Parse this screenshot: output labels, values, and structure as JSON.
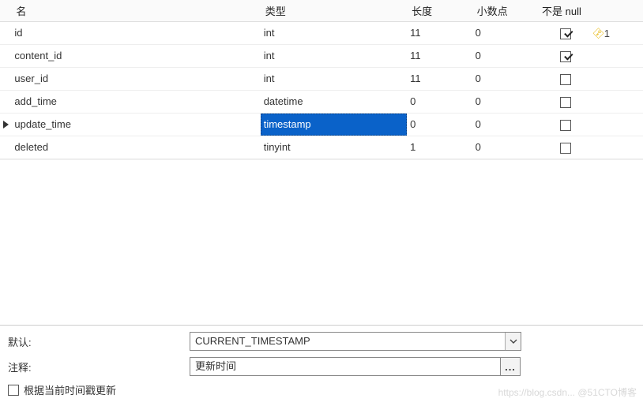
{
  "headers": {
    "name": "名",
    "type": "类型",
    "length": "长度",
    "decimals": "小数点",
    "not_null": "不是 null"
  },
  "rows": [
    {
      "name": "id",
      "type": "int",
      "length": "11",
      "decimals": "0",
      "not_null": true,
      "pk_index": "1",
      "current": false,
      "editing": false
    },
    {
      "name": "content_id",
      "type": "int",
      "length": "11",
      "decimals": "0",
      "not_null": true,
      "pk_index": "",
      "current": false,
      "editing": false
    },
    {
      "name": "user_id",
      "type": "int",
      "length": "11",
      "decimals": "0",
      "not_null": false,
      "pk_index": "",
      "current": false,
      "editing": false
    },
    {
      "name": "add_time",
      "type": "datetime",
      "length": "0",
      "decimals": "0",
      "not_null": false,
      "pk_index": "",
      "current": false,
      "editing": false
    },
    {
      "name": "update_time",
      "type": "timestamp",
      "length": "0",
      "decimals": "0",
      "not_null": false,
      "pk_index": "",
      "current": true,
      "editing": true
    },
    {
      "name": "deleted",
      "type": "tinyint",
      "length": "1",
      "decimals": "0",
      "not_null": false,
      "pk_index": "",
      "current": false,
      "editing": false
    }
  ],
  "form": {
    "default_label": "默认:",
    "default_value": "CURRENT_TIMESTAMP",
    "comment_label": "注释:",
    "comment_value": "更新时间",
    "on_update_label": "根据当前时间戳更新",
    "on_update_checked": false,
    "ellipsis": "..."
  },
  "watermark": "https://blog.csdn... @51CTO博客"
}
